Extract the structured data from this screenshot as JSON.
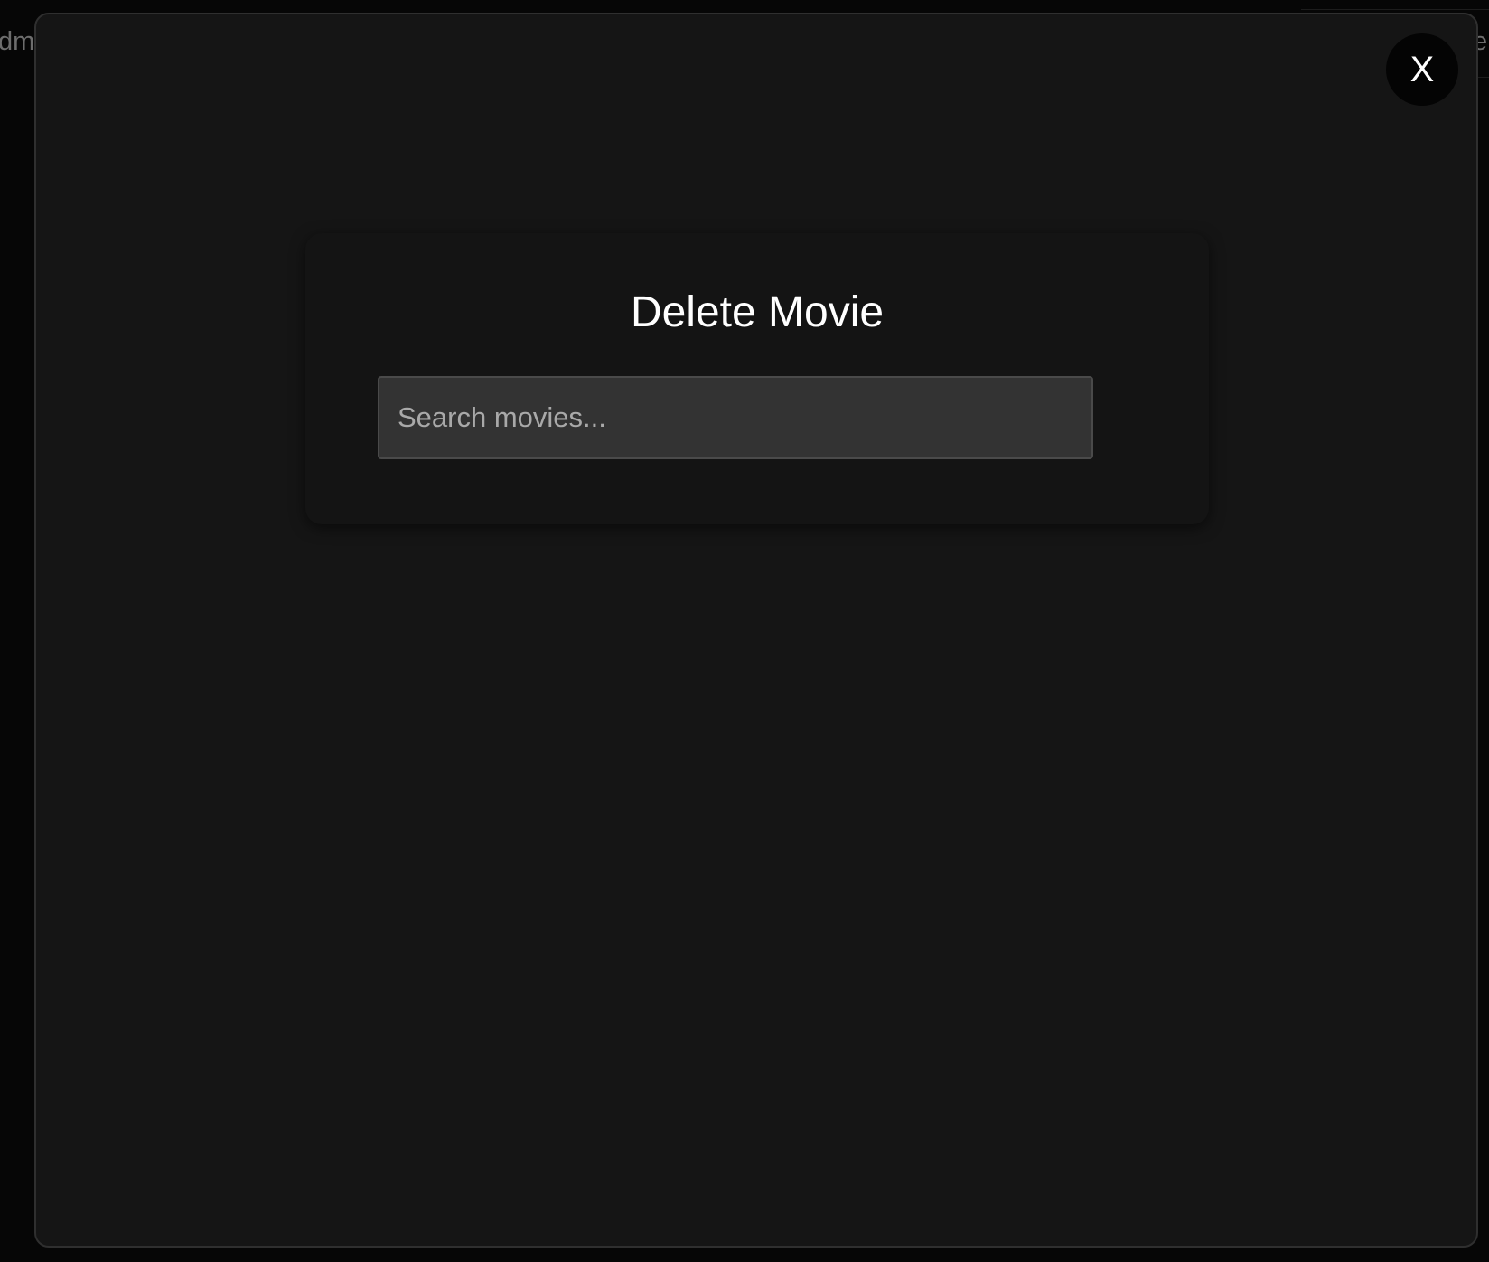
{
  "background": {
    "left_text": "dm",
    "right_text": "e"
  },
  "modal": {
    "close_label": "X",
    "title": "Delete Movie",
    "search": {
      "placeholder": "Search movies...",
      "value": ""
    }
  },
  "colors": {
    "backdrop": "#060606",
    "modal_background": "#151515",
    "card_background": "#141414",
    "input_background": "#333333",
    "close_button_background": "#040404",
    "title_text": "#ffffff"
  }
}
